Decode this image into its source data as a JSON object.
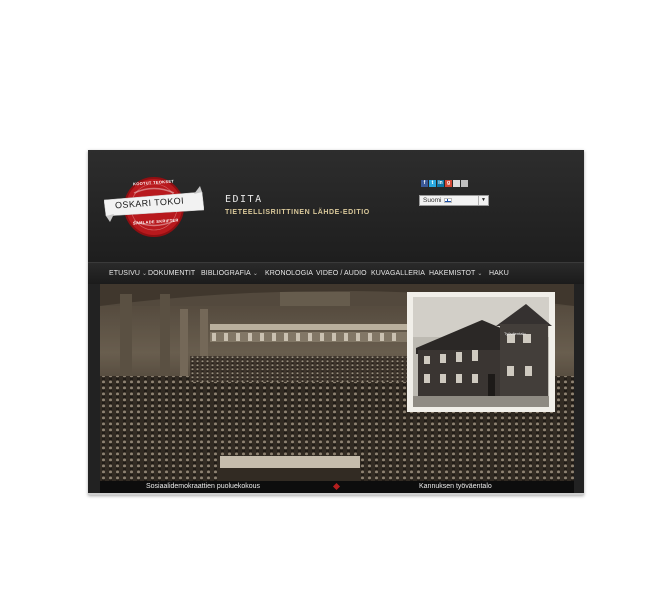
{
  "logo": {
    "top_text": "KOOTUT TEOKSET",
    "name": "OSKARI TOKOI",
    "bottom_text": "SAMLADE SKRIFTER"
  },
  "brand": {
    "name": "EDITA",
    "subtitle": "TIETEELLISRIITTINEN LÄHDE-EDITIO"
  },
  "social": [
    "facebook-icon",
    "twitter-icon",
    "linkedin-icon",
    "google-plus-icon",
    "email-icon",
    "print-icon"
  ],
  "language": {
    "selected": "Suomi"
  },
  "nav": [
    {
      "label": "ETUSIVU",
      "dropdown": true
    },
    {
      "label": "DOKUMENTIT",
      "dropdown": false
    },
    {
      "label": "BIBLIOGRAFIA",
      "dropdown": true
    },
    {
      "label": "KRONOLOGIA",
      "dropdown": false
    },
    {
      "label": "VIDEO / AUDIO",
      "dropdown": false
    },
    {
      "label": "KUVAGALLERIA",
      "dropdown": false
    },
    {
      "label": "HAKEMISTOT",
      "dropdown": true
    },
    {
      "label": "HAKU",
      "dropdown": false
    }
  ],
  "hero": {
    "inset_sign": "Työväentalo",
    "captions": {
      "left": "Sosiaalidemokraattien puoluekokous",
      "right": "Kannuksen työväentalo"
    }
  },
  "colors": {
    "header_bg": "#222222",
    "accent_red": "#b51e1e",
    "brand_sub": "#d9c89a"
  }
}
